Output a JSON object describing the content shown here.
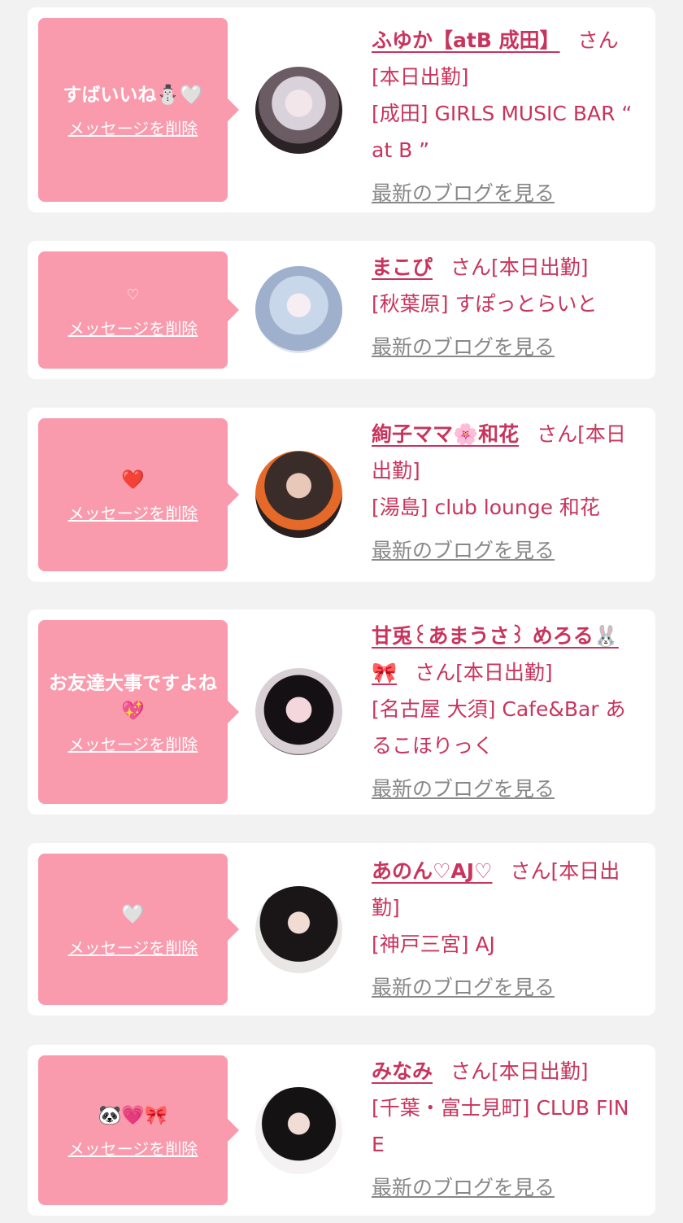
{
  "colors": {
    "accent": "#c8345d",
    "bubble": "#f99aad",
    "background": "#f2f2f3",
    "muted": "#888888"
  },
  "delete_label": "メッセージを削除",
  "blog_label": "最新のブログを見る",
  "cards": [
    {
      "message": "すばいいね⛄🤍",
      "name": "ふゆか【atB 成田】",
      "suffix": "さん",
      "status": "[本日出勤]",
      "shop": "[成田] GIRLS MUSIC BAR “ at B ”"
    },
    {
      "message": "♡",
      "name": "まこぴ",
      "suffix": "さん",
      "status": "[本日出勤]",
      "shop": "[秋葉原] すぽっとらいと"
    },
    {
      "message": "❤️",
      "name": "絢子ママ🌸和花",
      "suffix": "さん",
      "status": "[本日出勤]",
      "shop": "[湯島] club lounge 和花"
    },
    {
      "message": "お友達大事ですよね💖",
      "name": "甘兎꒰あまうさ꒱ めろる🐰🎀",
      "suffix": "さん",
      "status": "[本日出勤]",
      "shop": "[名古屋 大須] Cafe&Bar あるこほりっく"
    },
    {
      "message": "🤍",
      "name": "あのん♡AJ♡",
      "suffix": "さん",
      "status": "[本日出勤]",
      "shop": "[神戸三宮] AJ"
    },
    {
      "message": "🐼💗🎀",
      "name": "みなみ",
      "suffix": "さん",
      "status": "[本日出勤]",
      "shop": "[千葉・富士見町] CLUB FINE"
    }
  ]
}
